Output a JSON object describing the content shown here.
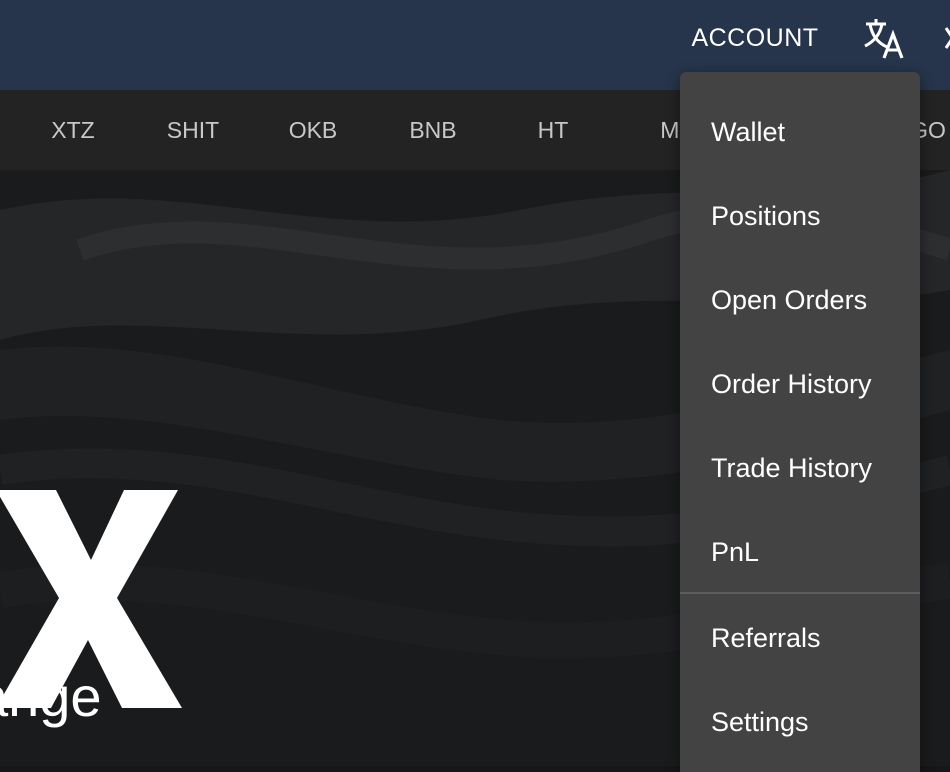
{
  "header": {
    "account_label": "ACCOUNT",
    "translate_icon": "translate-icon",
    "bg_color": "#26354b"
  },
  "ticker": {
    "items": [
      "XTZ",
      "SHIT",
      "OKB",
      "BNB",
      "HT",
      "MI",
      "GO"
    ]
  },
  "hero": {
    "logo_letter": "X",
    "subtitle": "ange"
  },
  "account_menu": {
    "items": [
      "Wallet",
      "Positions",
      "Open Orders",
      "Order History",
      "Trade History",
      "PnL"
    ],
    "secondary_items": [
      "Referrals",
      "Settings"
    ],
    "bg_color": "#434343"
  }
}
